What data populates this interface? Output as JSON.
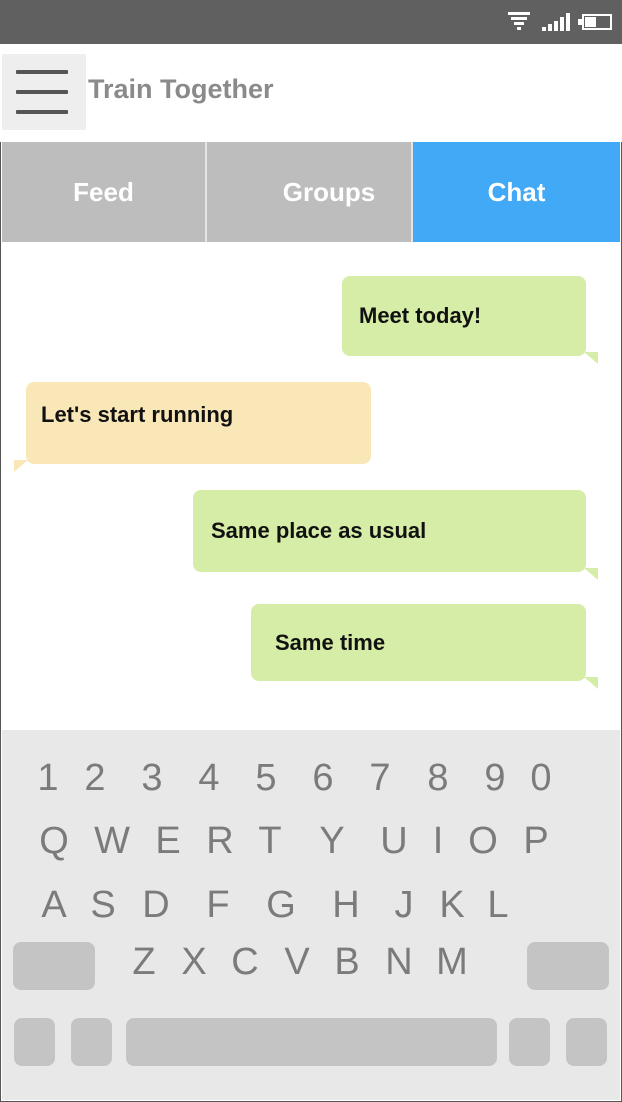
{
  "app": {
    "title": "Train Together"
  },
  "status_bar": {
    "icons": [
      "wifi-icon",
      "signal-icon",
      "battery-icon"
    ],
    "battery_level": 0.45
  },
  "tabs": [
    {
      "label": "Feed",
      "active": false
    },
    {
      "label": "Groups",
      "active": false
    },
    {
      "label": "Chat",
      "active": true
    }
  ],
  "messages": [
    {
      "text": "Meet today!",
      "direction": "outgoing"
    },
    {
      "text": "Let's start running",
      "direction": "incoming"
    },
    {
      "text": "Same place as usual",
      "direction": "outgoing"
    },
    {
      "text": "Same time",
      "direction": "outgoing"
    }
  ],
  "keyboard": {
    "rows": [
      [
        "1",
        "2",
        "3",
        "4",
        "5",
        "6",
        "7",
        "8",
        "9",
        "0"
      ],
      [
        "Q",
        "W",
        "E",
        "R",
        "T",
        "Y",
        "U",
        "I",
        "O",
        "P"
      ],
      [
        "A",
        "S",
        "D",
        "F",
        "G",
        "H",
        "J",
        "K",
        "L"
      ],
      [
        "Z",
        "X",
        "C",
        "V",
        "B",
        "N",
        "M"
      ]
    ]
  },
  "colors": {
    "status_bar": "#606060",
    "tab_inactive": "#bdbdbd",
    "tab_active": "#41a9f5",
    "bubble_outgoing": "#d5eda6",
    "bubble_incoming": "#f9e7b8",
    "keyboard_bg": "#e8e8e8"
  }
}
